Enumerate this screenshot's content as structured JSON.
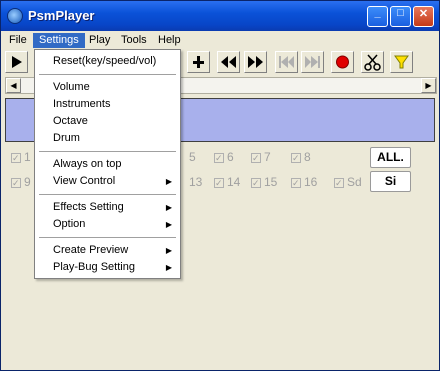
{
  "window": {
    "title": "PsmPlayer"
  },
  "menubar": {
    "items": [
      "File",
      "Settings",
      "Play",
      "Tools",
      "Help"
    ]
  },
  "settings_menu": {
    "items": [
      {
        "label": "Reset(key/speed/vol)",
        "submenu": false
      },
      {
        "label": "Volume",
        "submenu": false
      },
      {
        "label": "Instruments",
        "submenu": false
      },
      {
        "label": "Octave",
        "submenu": false
      },
      {
        "label": "Drum",
        "submenu": false
      },
      {
        "label": "Always on top",
        "submenu": false
      },
      {
        "label": "View Control",
        "submenu": true
      },
      {
        "label": "Effects Setting",
        "submenu": true
      },
      {
        "label": "Option",
        "submenu": true
      },
      {
        "label": "Create Preview",
        "submenu": true
      },
      {
        "label": "Play-Bug Setting",
        "submenu": true
      }
    ]
  },
  "channels": {
    "row1": [
      "1",
      "5",
      "6",
      "7",
      "8"
    ],
    "row2": [
      "9",
      "13",
      "14",
      "15",
      "16",
      "Sd"
    ]
  },
  "buttons": {
    "all": "ALL.",
    "si": "Si"
  },
  "colors": {
    "titlebar": "#0a52d8",
    "menu_highlight": "#316ac5",
    "track_panel": "#a8b0ec",
    "record": "#e00000"
  }
}
